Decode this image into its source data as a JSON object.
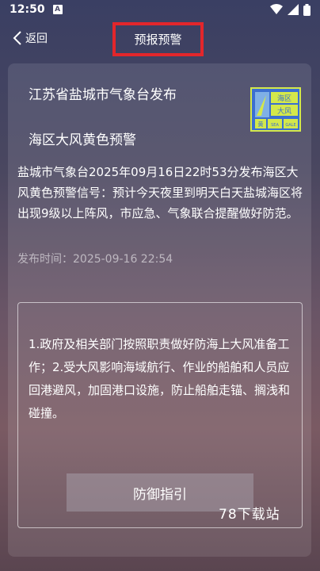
{
  "status_bar": {
    "time": "12:50",
    "notification_letter": "A"
  },
  "nav": {
    "back_label": "返回",
    "title": "预报预警"
  },
  "alert": {
    "issuer": "江苏省盐城市气象台发布",
    "title": "海区大风黄色预警",
    "icon_text_top": "海区",
    "icon_text_mid": "大风",
    "icon_text_sea": "SEA",
    "icon_text_gale": "GALE",
    "icon_text_yellow": "黄",
    "body": "盐城市气象台2025年09月16日22时53分发布海区大风黄色预警信号：预计今天夜里到明天白天盐城海区将出现9级以上阵风，市应急、气象联合提醒做好防范。",
    "publish_time_label": "发布时间：",
    "publish_time": "2025-09-16 22:54"
  },
  "guide": {
    "text": "1.政府及相关部门按照职责做好防海上大风准备工作；2.受大风影响海域航行、作业的船舶和人员应回港避风，加固港口设施，防止船舶走锚、搁浅和碰撞。",
    "button_label": "防御指引"
  },
  "watermark": "78下载站",
  "colors": {
    "highlight_border": "#e3262b",
    "icon_blue": "#3b6fd1",
    "icon_yellow": "#d4e84a"
  }
}
